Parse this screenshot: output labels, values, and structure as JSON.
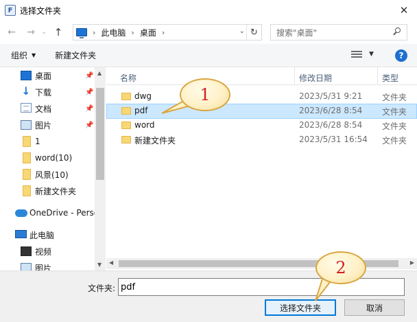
{
  "window": {
    "title": "选择文件夹"
  },
  "nav": {
    "breadcrumb": [
      "此电脑",
      "桌面"
    ],
    "search_placeholder": "搜索\"桌面\""
  },
  "toolbar": {
    "organize_label": "组织",
    "new_folder_label": "新建文件夹"
  },
  "sidebar": {
    "items": [
      {
        "label": "桌面",
        "icon": "desktop-icon",
        "pinned": true
      },
      {
        "label": "下载",
        "icon": "download-icon",
        "pinned": true
      },
      {
        "label": "文档",
        "icon": "document-icon",
        "pinned": true
      },
      {
        "label": "图片",
        "icon": "picture-icon",
        "pinned": true
      },
      {
        "label": "1",
        "icon": "folder-icon",
        "pinned": false
      },
      {
        "label": "word(10)",
        "icon": "folder-icon",
        "pinned": false
      },
      {
        "label": "风景(10)",
        "icon": "folder-icon",
        "pinned": false
      },
      {
        "label": "新建文件夹",
        "icon": "folder-icon",
        "pinned": false
      },
      {
        "label": "OneDrive - Perso",
        "icon": "onedrive-icon",
        "pinned": false
      },
      {
        "label": "此电脑",
        "icon": "this-pc-icon",
        "pinned": false
      },
      {
        "label": "视频",
        "icon": "video-icon",
        "pinned": false
      },
      {
        "label": "图片",
        "icon": "picture-icon",
        "pinned": false
      }
    ]
  },
  "filelist": {
    "columns": {
      "name": "名称",
      "modified": "修改日期",
      "type": "类型"
    },
    "rows": [
      {
        "name": "dwg",
        "modified": "2023/5/31 9:21",
        "type": "文件夹"
      },
      {
        "name": "pdf",
        "modified": "2023/6/28 8:54",
        "type": "文件夹",
        "selected": true
      },
      {
        "name": "word",
        "modified": "2023/6/28 8:54",
        "type": "文件夹"
      },
      {
        "name": "新建文件夹",
        "modified": "2023/5/31 16:54",
        "type": "文件夹"
      }
    ]
  },
  "footer": {
    "folder_label": "文件夹:",
    "folder_value": "pdf",
    "select_button": "选择文件夹",
    "cancel_button": "取消"
  },
  "annotations": {
    "callout_1": "1",
    "callout_2": "2"
  }
}
